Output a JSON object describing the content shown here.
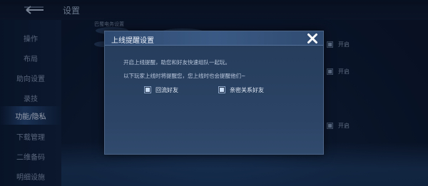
{
  "header": {
    "page_title": "设置",
    "section_label": "巴蜀电务设置"
  },
  "sidebar": {
    "items": [
      {
        "label": "操作"
      },
      {
        "label": "布局"
      },
      {
        "label": "助向设置"
      },
      {
        "label": "录技"
      },
      {
        "label": "功能/隐私"
      },
      {
        "label": "下载管理"
      },
      {
        "label": "二维备码"
      },
      {
        "label": "明细设施"
      }
    ],
    "active_index": 4
  },
  "background_toggles": [
    {
      "label": "开启",
      "checked": true
    },
    {
      "label": "开启",
      "checked": true
    },
    {
      "label": "开启",
      "checked": true
    }
  ],
  "modal": {
    "title": "上线提醒设置",
    "line1": "开启上线提醒，助您和好友快速组队一起玩。",
    "line2": "以下玩家上线时将提醒您，您上线时也会提醒他们~",
    "options": [
      {
        "label": "回流好友",
        "checked": true
      },
      {
        "label": "亲密关系好友",
        "checked": true
      }
    ]
  },
  "colors": {
    "modal_bg": "#2a4263",
    "header_bg": "#3a5a85",
    "text_primary": "#e2eaf6",
    "text_secondary": "#b9c7dc"
  }
}
